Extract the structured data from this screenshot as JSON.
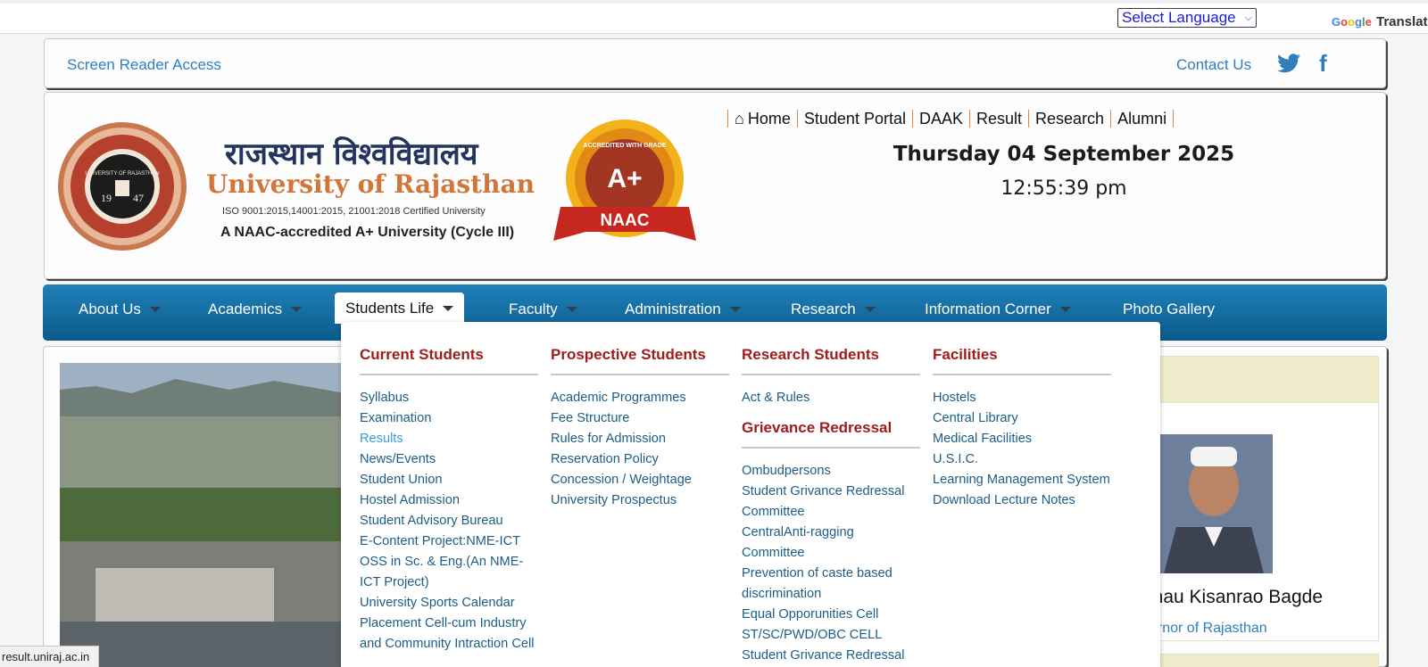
{
  "translate": {
    "select_label": "Select Language",
    "google_letters": [
      "G",
      "o",
      "o",
      "g",
      "l",
      "e"
    ],
    "translate_label": "Translat"
  },
  "access_bar": {
    "screen_reader": "Screen Reader Access",
    "contact": "Contact Us"
  },
  "header": {
    "title_hindi": "राजस्थान विश्वविद्यालय",
    "title_en": "University of Rajasthan",
    "iso": "ISO 9001:2015,14001:2015, 21001:2018 Certified University",
    "naac": "A NAAC-accredited A+ University (Cycle III)",
    "badge": {
      "ring_text": "ACCREDITED WITH GRADE",
      "grade": "A+",
      "ribbon": "NAAC"
    },
    "seal": {
      "ring_text": "UNIVERSITY OF RAJASTHAN",
      "year_left": "19",
      "year_right": "47"
    },
    "top_links": [
      "Home",
      "Student Portal",
      "DAAK",
      "Result",
      "Research",
      "Alumni"
    ],
    "date": "Thursday 04 September 2025",
    "time": "12:55:39 pm"
  },
  "nav": {
    "items": [
      "About Us",
      "Academics",
      "Students Life",
      "Faculty",
      "Administration",
      "Research",
      "Information Corner",
      "Photo Gallery"
    ]
  },
  "mega_menu": {
    "current": {
      "heading": "Current Students",
      "items": [
        "Syllabus",
        "Examination",
        "Results",
        "News/Events",
        "Student Union",
        "Hostel Admission",
        "Student Advisory Bureau",
        "E-Content Project:NME-ICT",
        "OSS in Sc. & Eng.(An NME-ICT Project)",
        "University Sports Calendar",
        "Placement Cell-cum Industry and Community Intraction Cell"
      ]
    },
    "prospective": {
      "heading": "Prospective Students",
      "items": [
        "Academic Programmes",
        "Fee Structure",
        "Rules for Admission",
        "Reservation Policy",
        "Concession / Weightage",
        "University Prospectus"
      ]
    },
    "research": {
      "heading": "Research Students",
      "items": [
        "Act & Rules"
      ]
    },
    "grievance": {
      "heading": "Grievance Redressal",
      "items": [
        "Ombudpersons",
        "Student Grivance Redressal Committee",
        "CentralAnti-ragging Committee",
        "Prevention of caste based discrimination",
        "Equal Opporunities Cell",
        "ST/SC/PWD/OBC CELL",
        "Student Grivance Redressal"
      ]
    },
    "facilities": {
      "heading": "Facilities",
      "items": [
        "Hostels",
        "Central Library",
        "Medical Facilities",
        "U.S.I.C.",
        "Learning Management System",
        "Download Lecture Notes"
      ]
    }
  },
  "governor": {
    "name": "ohau Kisanrao Bagde",
    "title": "vernor of Rajasthan"
  },
  "status_bar": "result.uniraj.ac.in",
  "colors": {
    "nav_top": "#1f80b8",
    "nav_bottom": "#0c5a8a",
    "heading_red": "#9e1c1c",
    "link_blue": "#1d5d85"
  }
}
